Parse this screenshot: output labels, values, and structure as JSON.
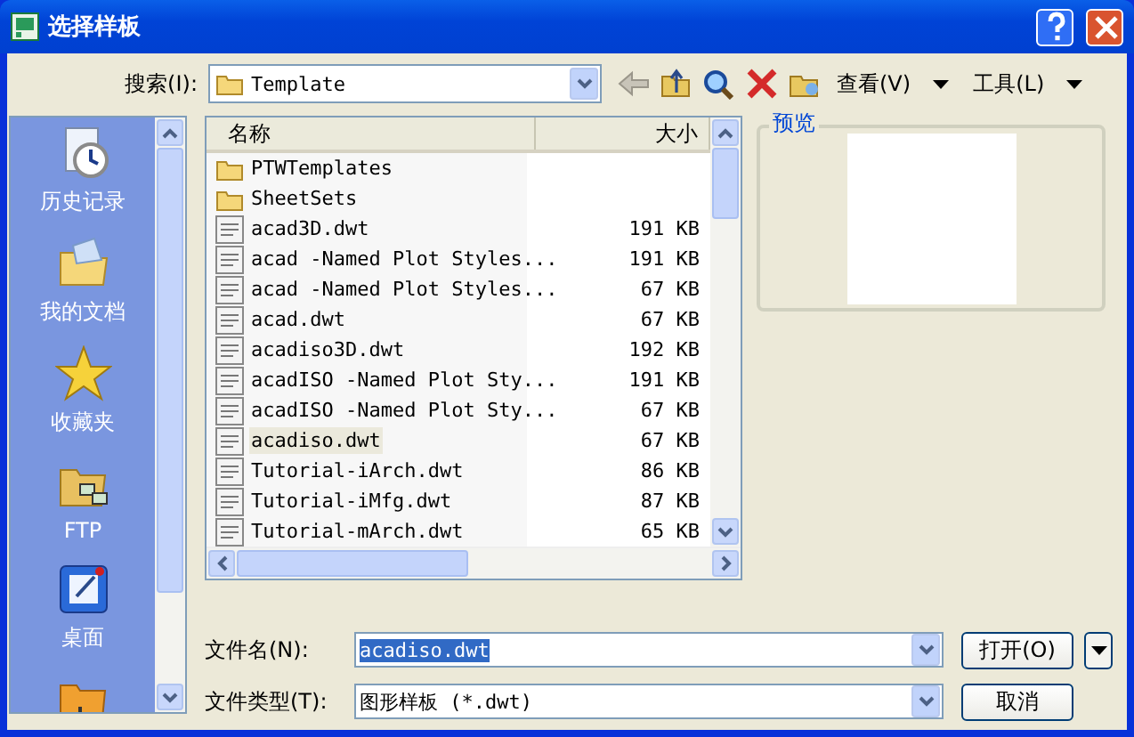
{
  "window": {
    "title": "选择样板"
  },
  "search": {
    "label": "搜索(I):",
    "value": "Template"
  },
  "toolbar": {
    "view": "查看(V)",
    "tools": "工具(L)"
  },
  "places": [
    {
      "label": "历史记录",
      "kind": "history"
    },
    {
      "label": "我的文档",
      "kind": "documents"
    },
    {
      "label": "收藏夹",
      "kind": "favorites"
    },
    {
      "label": "FTP",
      "kind": "ftp"
    },
    {
      "label": "桌面",
      "kind": "desktop"
    },
    {
      "kind": "buzzsaw"
    }
  ],
  "file_list": {
    "columns": [
      "名称",
      "大小"
    ],
    "rows": [
      {
        "name": "PTWTemplates",
        "kind": "folder",
        "selected": false
      },
      {
        "name": "SheetSets",
        "kind": "folder",
        "selected": false
      },
      {
        "name": "acad3D.dwt",
        "size": "191 KB",
        "kind": "dwt",
        "selected": false
      },
      {
        "name": "acad -Named Plot Styles...",
        "size": "191 KB",
        "kind": "dwt",
        "selected": false
      },
      {
        "name": "acad -Named Plot Styles...",
        "size": "67 KB",
        "kind": "dwt",
        "selected": false
      },
      {
        "name": "acad.dwt",
        "size": "67 KB",
        "kind": "dwt",
        "selected": false
      },
      {
        "name": "acadiso3D.dwt",
        "size": "192 KB",
        "kind": "dwt",
        "selected": false
      },
      {
        "name": "acadISO -Named Plot Sty...",
        "size": "191 KB",
        "kind": "dwt",
        "selected": false
      },
      {
        "name": "acadISO -Named Plot Sty...",
        "size": "67 KB",
        "kind": "dwt",
        "selected": false
      },
      {
        "name": "acadiso.dwt",
        "size": "67 KB",
        "kind": "dwt",
        "selected": true
      },
      {
        "name": "Tutorial-iArch.dwt",
        "size": "86 KB",
        "kind": "dwt",
        "selected": false
      },
      {
        "name": "Tutorial-iMfg.dwt",
        "size": "87 KB",
        "kind": "dwt",
        "selected": false
      },
      {
        "name": "Tutorial-mArch.dwt",
        "size": "65 KB",
        "kind": "dwt",
        "selected": false
      }
    ]
  },
  "preview": {
    "label": "预览"
  },
  "filename": {
    "label": "文件名(N):",
    "value": "acadiso.dwt"
  },
  "filetype": {
    "label": "文件类型(T):",
    "value": "图形样板 (*.dwt)"
  },
  "buttons": {
    "open": "打开(O)",
    "cancel": "取消"
  }
}
